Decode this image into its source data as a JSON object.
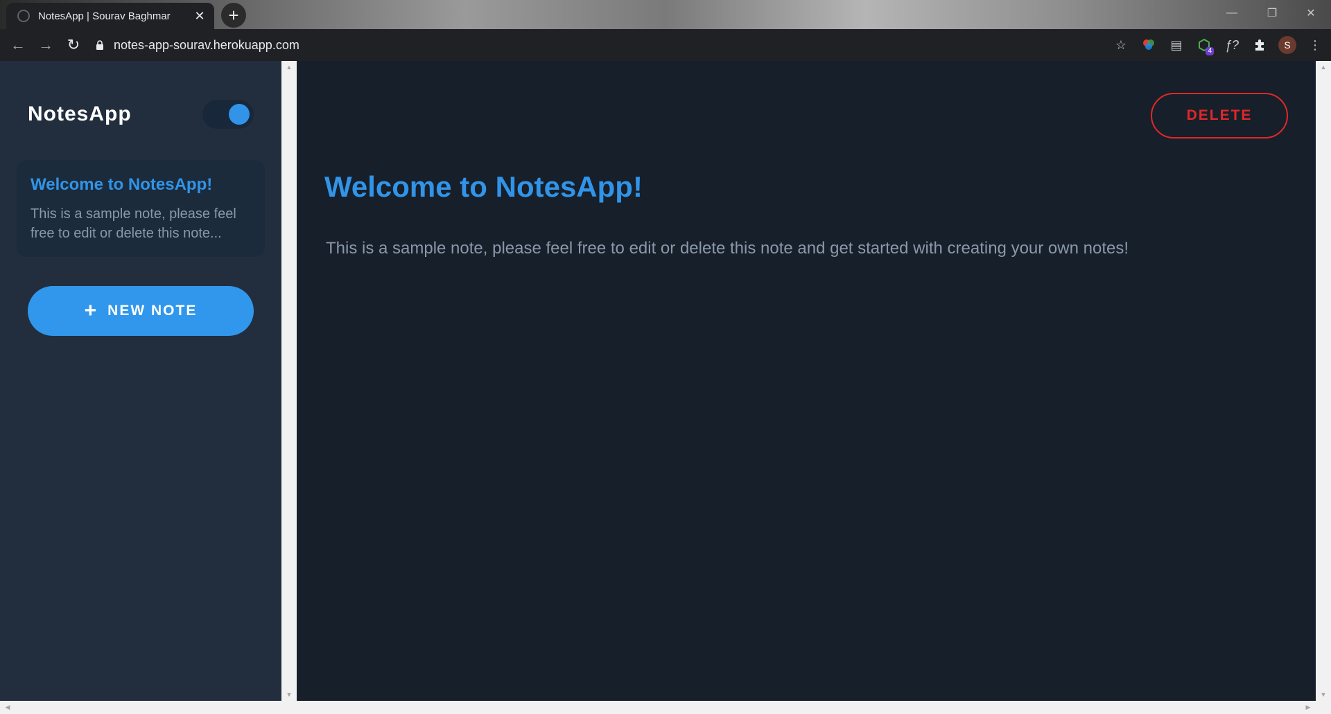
{
  "browser": {
    "tab_title": "NotesApp | Sourav Baghmar",
    "url": "notes-app-sourav.herokuapp.com",
    "profile_initial": "S",
    "extension_badge": "4"
  },
  "sidebar": {
    "brand": "NotesApp",
    "theme_toggle_on": true,
    "notes": [
      {
        "title": "Welcome to NotesApp!",
        "preview": "This is a sample note, please feel free to edit or delete this note..."
      }
    ],
    "new_note_label": "NEW NOTE"
  },
  "main": {
    "delete_label": "DELETE",
    "note_title": "Welcome to NotesApp!",
    "note_body": "This is a sample note, please feel free to edit or delete this note and get started with creating your own notes!"
  },
  "colors": {
    "accent": "#3194e8",
    "danger": "#e02828",
    "sidebar_bg": "#222e3e",
    "main_bg": "#171f2a"
  }
}
